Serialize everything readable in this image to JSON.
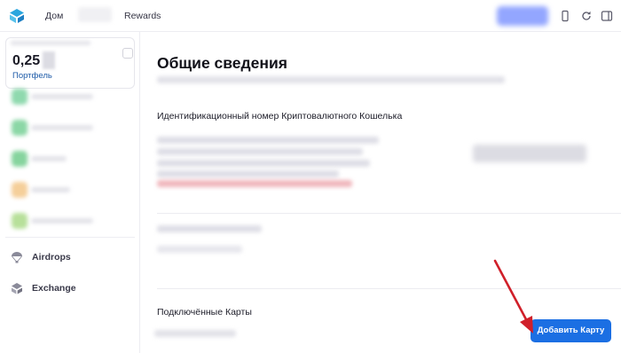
{
  "header": {
    "nav": [
      {
        "label": "Дом"
      },
      {
        "label": "Rewards"
      }
    ],
    "icons": [
      "logo-icon",
      "phone-icon",
      "refresh-icon",
      "collapse-icon"
    ],
    "accent_color": "#1b6fe3"
  },
  "sidebar": {
    "portfolio": {
      "value": "0,25",
      "label": "Портфель"
    },
    "asset_colors": [
      "#8fd9ae",
      "#8bd7a6",
      "#86d49e",
      "#f5cf9a",
      "#b7e09a"
    ],
    "links": [
      {
        "label": "Airdrops",
        "icon": "parachute-icon"
      },
      {
        "label": "Exchange",
        "icon": "exchange-icon"
      }
    ]
  },
  "main": {
    "title": "Общие сведения",
    "wallet_id_label": "Идентификационный номер Криптовалютного Кошелька",
    "connected_cards_label": "Подключённые Карты",
    "add_card_button": "Добавить Карту",
    "annotation_arrow_color": "#d0202a"
  }
}
